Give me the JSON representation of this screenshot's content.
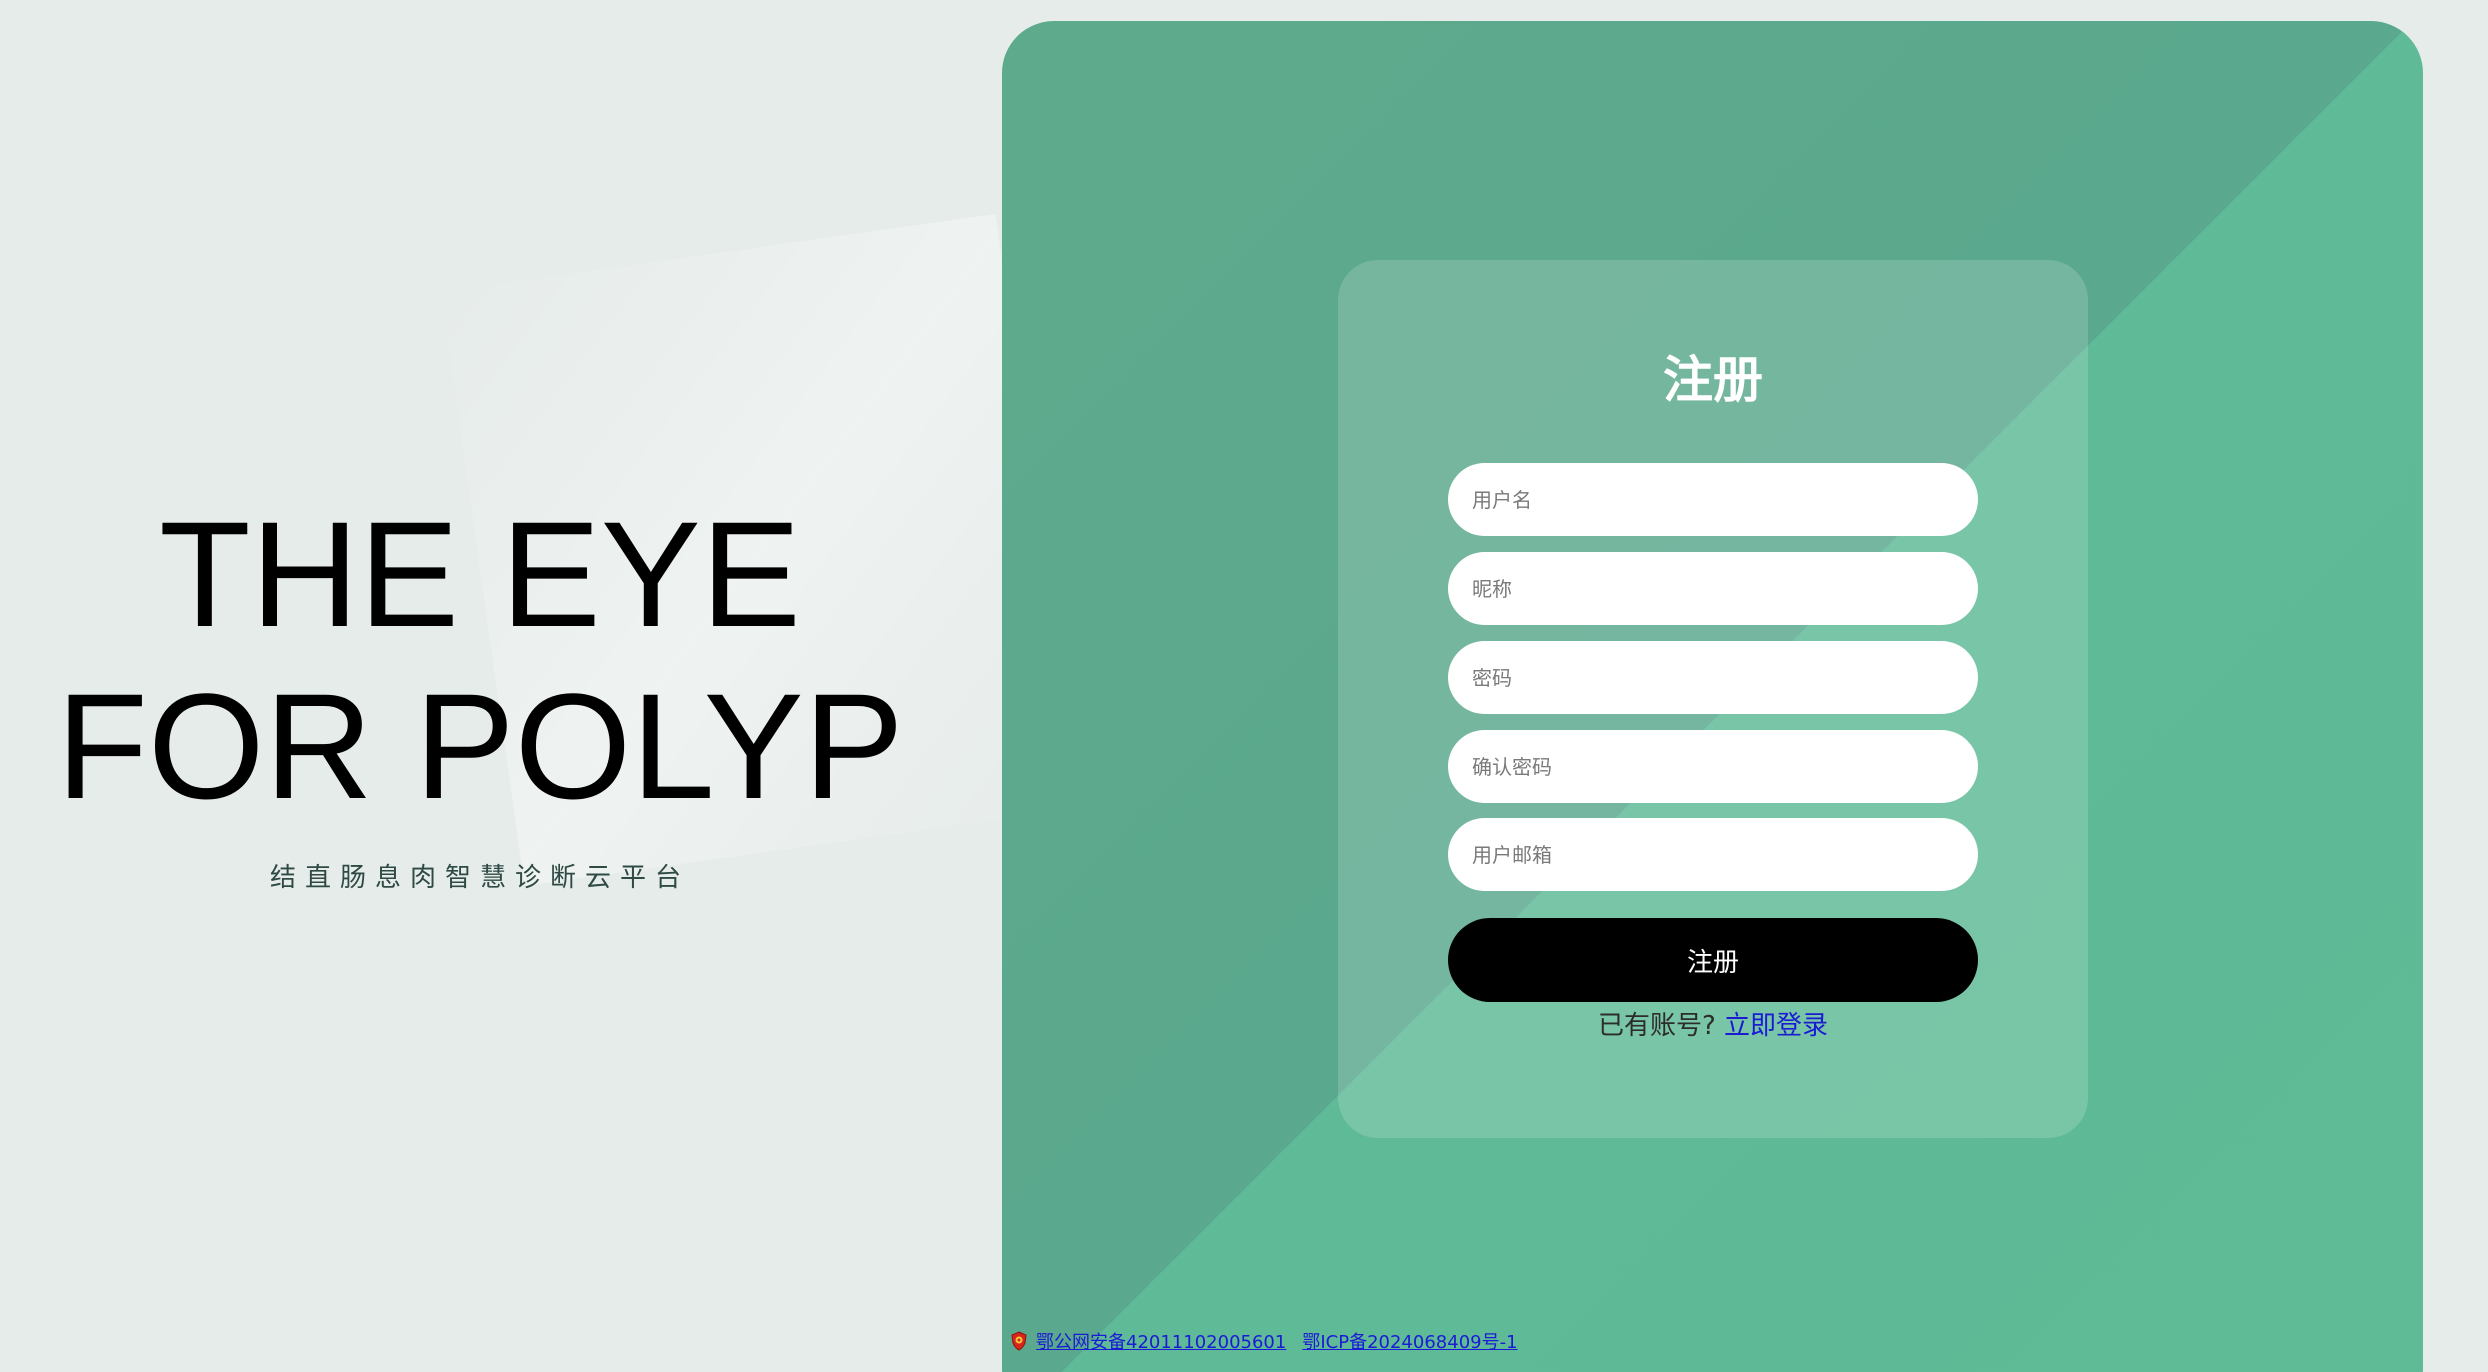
{
  "brand": {
    "title_line1": "THE EYE",
    "title_line2": "FOR POLYP",
    "subtitle": "结直肠息肉智慧诊断云平台"
  },
  "register": {
    "title": "注册",
    "fields": {
      "username_placeholder": "用户名",
      "nickname_placeholder": "昵称",
      "password_placeholder": "密码",
      "confirm_password_placeholder": "确认密码",
      "email_placeholder": "用户邮箱"
    },
    "submit_label": "注册",
    "login_prompt": "已有账号?",
    "login_link": "立即登录"
  },
  "footer": {
    "police_record": "鄂公网安备42011102005601",
    "icp_record": "鄂ICP备2024068409号-1",
    "police_icon": "police-badge-icon"
  },
  "colors": {
    "background": "#e6ecea",
    "panel_green": "#5eaa8d",
    "button_black": "#000000",
    "link_blue": "#1b1bd6"
  }
}
